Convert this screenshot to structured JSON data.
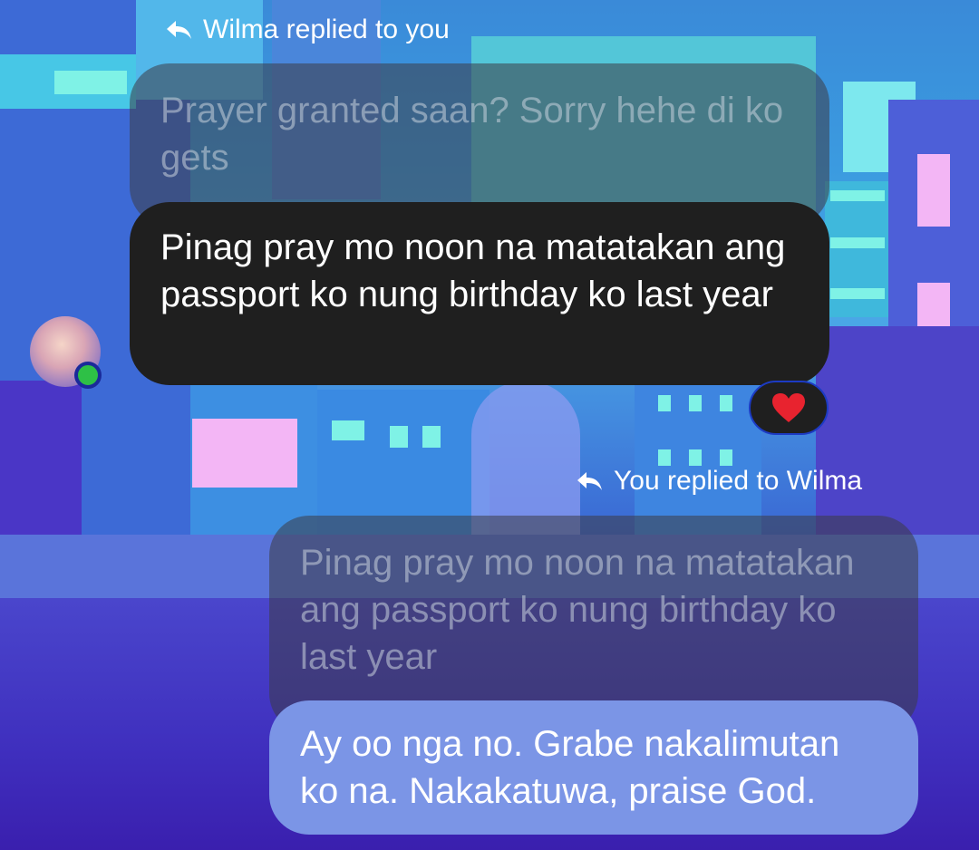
{
  "thread": {
    "incoming_reply_label": "Wilma replied to you",
    "incoming_quoted": "Prayer granted saan? Sorry hehe di ko gets",
    "incoming_message": "Pinag pray mo noon na matatakan ang passport ko nung birthday ko last year",
    "reaction_emoji": "❤️",
    "outgoing_reply_label": "You replied to Wilma",
    "outgoing_quoted": "Pinag pray mo noon na matatakan ang passport ko nung birthday ko last year",
    "outgoing_message": "Ay oo nga no. Grabe nakalimutan ko na. Nakakatuwa, praise God."
  },
  "colors": {
    "incoming_bubble": "#1f1f1f",
    "outgoing_bubble": "#7b95e6",
    "presence_online": "#2ec046",
    "reaction_heart": "#e8232f"
  },
  "icons": {
    "reply": "reply-arrow-icon",
    "reaction": "heart-icon"
  }
}
